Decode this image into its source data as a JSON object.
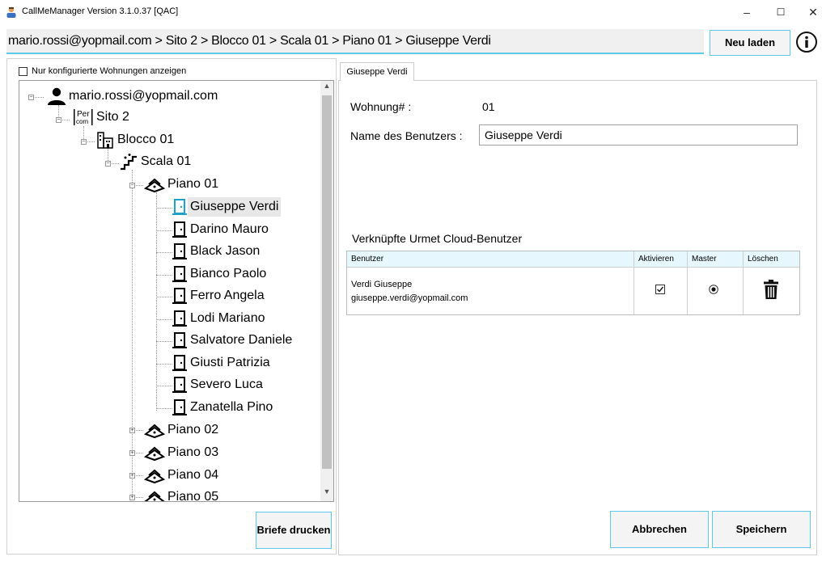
{
  "window": {
    "title": "CallMeManager Version 3.1.0.37 [QAC]",
    "minimize": "–",
    "maximize": "☐",
    "close": "✕"
  },
  "header": {
    "breadcrumb": "mario.rossi@yopmail.com > Sito 2 > Blocco 01 > Scala 01 > Piano 01 > Giuseppe Verdi",
    "reload_label": "Neu laden"
  },
  "left": {
    "filter_label": "Nur konfigurierte Wohnungen anzeigen",
    "print_label": "Briefe drucken",
    "tree": {
      "account": "mario.rossi@yopmail.com",
      "site": "Sito 2",
      "block": "Blocco 01",
      "stair": "Scala 01",
      "floor_open": "Piano 01",
      "users": [
        "Giuseppe Verdi",
        "Darino Mauro",
        "Black Jason",
        "Bianco Paolo",
        "Ferro Angela",
        "Lodi Mariano",
        "Salvatore Daniele",
        "Giusti Patrizia",
        "Severo Luca",
        "Zanatella Pino"
      ],
      "floors_closed": [
        "Piano 02",
        "Piano 03",
        "Piano 04",
        "Piano 05"
      ]
    }
  },
  "right": {
    "tab_label": "Giuseppe Verdi",
    "apartment_label": "Wohnung# :",
    "apartment_value": "01",
    "username_label": "Name des Benutzers :",
    "username_value": "Giuseppe Verdi",
    "linked_title": "Verknüpfte Urmet Cloud-Benutzer",
    "grid": {
      "headers": [
        "Benutzer",
        "Aktivieren",
        "Master",
        "Löschen"
      ],
      "rows": [
        {
          "name": "Verdi Giuseppe",
          "email": "giuseppe.verdi@yopmail.com",
          "active": true,
          "master": true
        }
      ]
    },
    "cancel_label": "Abbrechen",
    "save_label": "Speichern"
  },
  "colors": {
    "accent": "#5ec8e6",
    "header_bg": "#e6f8fd",
    "selected_user_icon": "#1ea2c9"
  }
}
